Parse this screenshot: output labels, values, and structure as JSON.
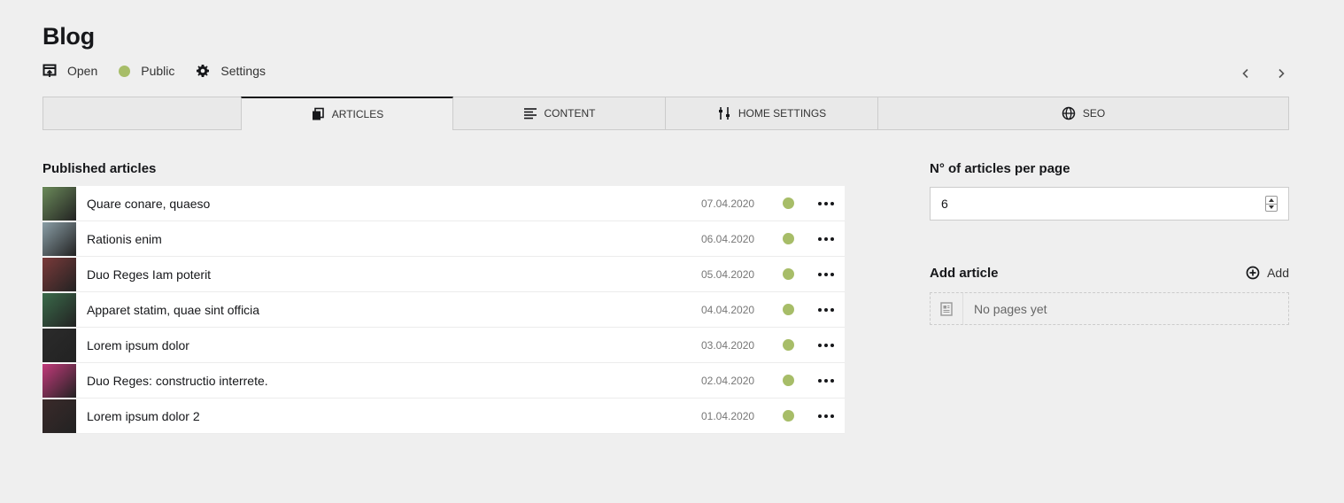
{
  "page": {
    "title": "Blog",
    "actions": [
      {
        "label": "Open",
        "icon": "open-icon"
      },
      {
        "label": "Public",
        "icon": "status-dot-icon"
      },
      {
        "label": "Settings",
        "icon": "gear-icon"
      }
    ]
  },
  "tabs": [
    {
      "label": "Articles",
      "icon": "articles-icon",
      "active": true
    },
    {
      "label": "Content",
      "icon": "content-icon",
      "active": false
    },
    {
      "label": "Home settings",
      "icon": "sliders-icon",
      "active": false
    },
    {
      "label": "SEO",
      "icon": "globe-icon",
      "active": false
    }
  ],
  "published": {
    "label": "Published articles",
    "rows": [
      {
        "title": "Quare conare, quaeso",
        "date": "07.04.2020",
        "thumb_color": "#6b8a5a"
      },
      {
        "title": "Rationis enim",
        "date": "06.04.2020",
        "thumb_color": "#8a9ea6"
      },
      {
        "title": "Duo Reges Iam poterit",
        "date": "05.04.2020",
        "thumb_color": "#7a3a3a"
      },
      {
        "title": "Apparet statim, quae sint officia",
        "date": "04.04.2020",
        "thumb_color": "#3a6a4a"
      },
      {
        "title": "Lorem ipsum dolor",
        "date": "03.04.2020",
        "thumb_color": "#2b2b2b"
      },
      {
        "title": "Duo Reges: constructio interrete.",
        "date": "02.04.2020",
        "thumb_color": "#c23a7a"
      },
      {
        "title": "Lorem ipsum dolor 2",
        "date": "01.04.2020",
        "thumb_color": "#3a2a2a"
      }
    ]
  },
  "settings": {
    "per_page_label": "N° of articles per page",
    "per_page_value": "6"
  },
  "add_article": {
    "label": "Add article",
    "button": "Add",
    "empty_text": "No pages yet"
  },
  "colors": {
    "status_public": "#a7bd68",
    "background": "#efefef"
  }
}
